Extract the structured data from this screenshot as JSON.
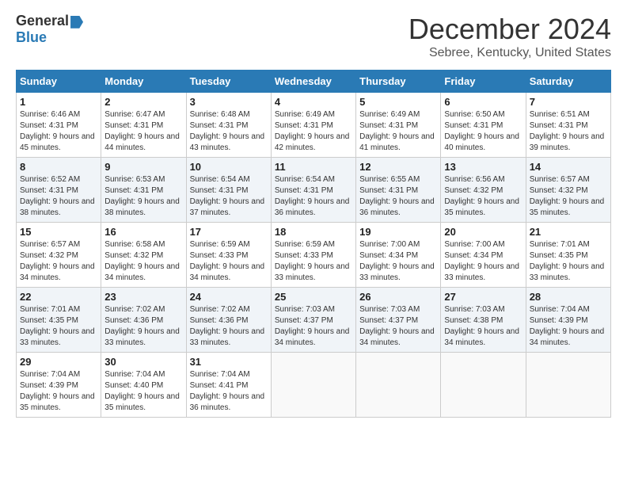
{
  "logo": {
    "general": "General",
    "blue": "Blue"
  },
  "title": "December 2024",
  "subtitle": "Sebree, Kentucky, United States",
  "headers": [
    "Sunday",
    "Monday",
    "Tuesday",
    "Wednesday",
    "Thursday",
    "Friday",
    "Saturday"
  ],
  "weeks": [
    [
      {
        "day": "1",
        "info": "Sunrise: 6:46 AM\nSunset: 4:31 PM\nDaylight: 9 hours and 45 minutes."
      },
      {
        "day": "2",
        "info": "Sunrise: 6:47 AM\nSunset: 4:31 PM\nDaylight: 9 hours and 44 minutes."
      },
      {
        "day": "3",
        "info": "Sunrise: 6:48 AM\nSunset: 4:31 PM\nDaylight: 9 hours and 43 minutes."
      },
      {
        "day": "4",
        "info": "Sunrise: 6:49 AM\nSunset: 4:31 PM\nDaylight: 9 hours and 42 minutes."
      },
      {
        "day": "5",
        "info": "Sunrise: 6:49 AM\nSunset: 4:31 PM\nDaylight: 9 hours and 41 minutes."
      },
      {
        "day": "6",
        "info": "Sunrise: 6:50 AM\nSunset: 4:31 PM\nDaylight: 9 hours and 40 minutes."
      },
      {
        "day": "7",
        "info": "Sunrise: 6:51 AM\nSunset: 4:31 PM\nDaylight: 9 hours and 39 minutes."
      }
    ],
    [
      {
        "day": "8",
        "info": "Sunrise: 6:52 AM\nSunset: 4:31 PM\nDaylight: 9 hours and 38 minutes."
      },
      {
        "day": "9",
        "info": "Sunrise: 6:53 AM\nSunset: 4:31 PM\nDaylight: 9 hours and 38 minutes."
      },
      {
        "day": "10",
        "info": "Sunrise: 6:54 AM\nSunset: 4:31 PM\nDaylight: 9 hours and 37 minutes."
      },
      {
        "day": "11",
        "info": "Sunrise: 6:54 AM\nSunset: 4:31 PM\nDaylight: 9 hours and 36 minutes."
      },
      {
        "day": "12",
        "info": "Sunrise: 6:55 AM\nSunset: 4:31 PM\nDaylight: 9 hours and 36 minutes."
      },
      {
        "day": "13",
        "info": "Sunrise: 6:56 AM\nSunset: 4:32 PM\nDaylight: 9 hours and 35 minutes."
      },
      {
        "day": "14",
        "info": "Sunrise: 6:57 AM\nSunset: 4:32 PM\nDaylight: 9 hours and 35 minutes."
      }
    ],
    [
      {
        "day": "15",
        "info": "Sunrise: 6:57 AM\nSunset: 4:32 PM\nDaylight: 9 hours and 34 minutes."
      },
      {
        "day": "16",
        "info": "Sunrise: 6:58 AM\nSunset: 4:32 PM\nDaylight: 9 hours and 34 minutes."
      },
      {
        "day": "17",
        "info": "Sunrise: 6:59 AM\nSunset: 4:33 PM\nDaylight: 9 hours and 34 minutes."
      },
      {
        "day": "18",
        "info": "Sunrise: 6:59 AM\nSunset: 4:33 PM\nDaylight: 9 hours and 33 minutes."
      },
      {
        "day": "19",
        "info": "Sunrise: 7:00 AM\nSunset: 4:34 PM\nDaylight: 9 hours and 33 minutes."
      },
      {
        "day": "20",
        "info": "Sunrise: 7:00 AM\nSunset: 4:34 PM\nDaylight: 9 hours and 33 minutes."
      },
      {
        "day": "21",
        "info": "Sunrise: 7:01 AM\nSunset: 4:35 PM\nDaylight: 9 hours and 33 minutes."
      }
    ],
    [
      {
        "day": "22",
        "info": "Sunrise: 7:01 AM\nSunset: 4:35 PM\nDaylight: 9 hours and 33 minutes."
      },
      {
        "day": "23",
        "info": "Sunrise: 7:02 AM\nSunset: 4:36 PM\nDaylight: 9 hours and 33 minutes."
      },
      {
        "day": "24",
        "info": "Sunrise: 7:02 AM\nSunset: 4:36 PM\nDaylight: 9 hours and 33 minutes."
      },
      {
        "day": "25",
        "info": "Sunrise: 7:03 AM\nSunset: 4:37 PM\nDaylight: 9 hours and 34 minutes."
      },
      {
        "day": "26",
        "info": "Sunrise: 7:03 AM\nSunset: 4:37 PM\nDaylight: 9 hours and 34 minutes."
      },
      {
        "day": "27",
        "info": "Sunrise: 7:03 AM\nSunset: 4:38 PM\nDaylight: 9 hours and 34 minutes."
      },
      {
        "day": "28",
        "info": "Sunrise: 7:04 AM\nSunset: 4:39 PM\nDaylight: 9 hours and 34 minutes."
      }
    ],
    [
      {
        "day": "29",
        "info": "Sunrise: 7:04 AM\nSunset: 4:39 PM\nDaylight: 9 hours and 35 minutes."
      },
      {
        "day": "30",
        "info": "Sunrise: 7:04 AM\nSunset: 4:40 PM\nDaylight: 9 hours and 35 minutes."
      },
      {
        "day": "31",
        "info": "Sunrise: 7:04 AM\nSunset: 4:41 PM\nDaylight: 9 hours and 36 minutes."
      },
      {
        "day": "",
        "info": ""
      },
      {
        "day": "",
        "info": ""
      },
      {
        "day": "",
        "info": ""
      },
      {
        "day": "",
        "info": ""
      }
    ]
  ]
}
